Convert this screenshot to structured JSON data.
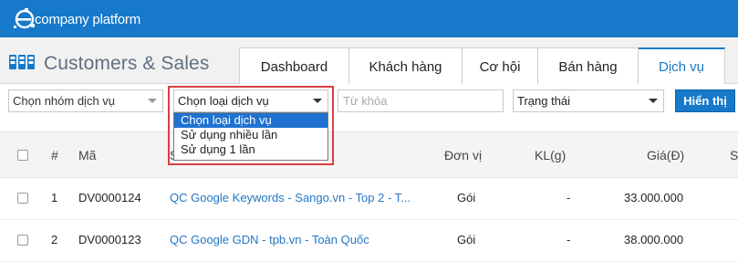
{
  "brand": {
    "logo_text": "company platform"
  },
  "module": {
    "title": "Customers & Sales"
  },
  "tabs": [
    {
      "label": "Dashboard",
      "active": false
    },
    {
      "label": "Khách hàng",
      "active": false
    },
    {
      "label": "Cơ hội",
      "active": false
    },
    {
      "label": "Bán hàng",
      "active": false
    },
    {
      "label": "Dịch vụ",
      "active": true
    }
  ],
  "filters": {
    "group_select": "Chọn nhóm dịch vụ",
    "type_select": "Chọn loại dịch vụ",
    "keyword_placeholder": "Từ khóa",
    "status_select": "Trạng thái",
    "show_button": "Hiển thị"
  },
  "type_dropdown": {
    "options": [
      "Chọn loại dịch vụ",
      "Sử dụng nhiều lần",
      "Sử dụng 1 lần"
    ],
    "highlighted_index": 0
  },
  "table": {
    "headers": {
      "index": "#",
      "code": "Mã",
      "name": "S",
      "unit": "Đơn vị",
      "weight": "KL(g)",
      "price": "Giá(Đ)",
      "extra": "S"
    },
    "rows": [
      {
        "index": "1",
        "code": "DV0000124",
        "name": "QC Google Keywords - Sango.vn - Top 2 - T...",
        "unit": "Gói",
        "weight": "-",
        "price": "33.000.000"
      },
      {
        "index": "2",
        "code": "DV0000123",
        "name": "QC Google GDN - tpb.vn - Toàn Quốc",
        "unit": "Gói",
        "weight": "-",
        "price": "38.000.000"
      }
    ]
  },
  "colors": {
    "brand_blue": "#1679c9",
    "highlight_red": "#d94040"
  },
  "icons": {
    "logo": "e-logo-icon",
    "module": "grid-apps-icon"
  }
}
